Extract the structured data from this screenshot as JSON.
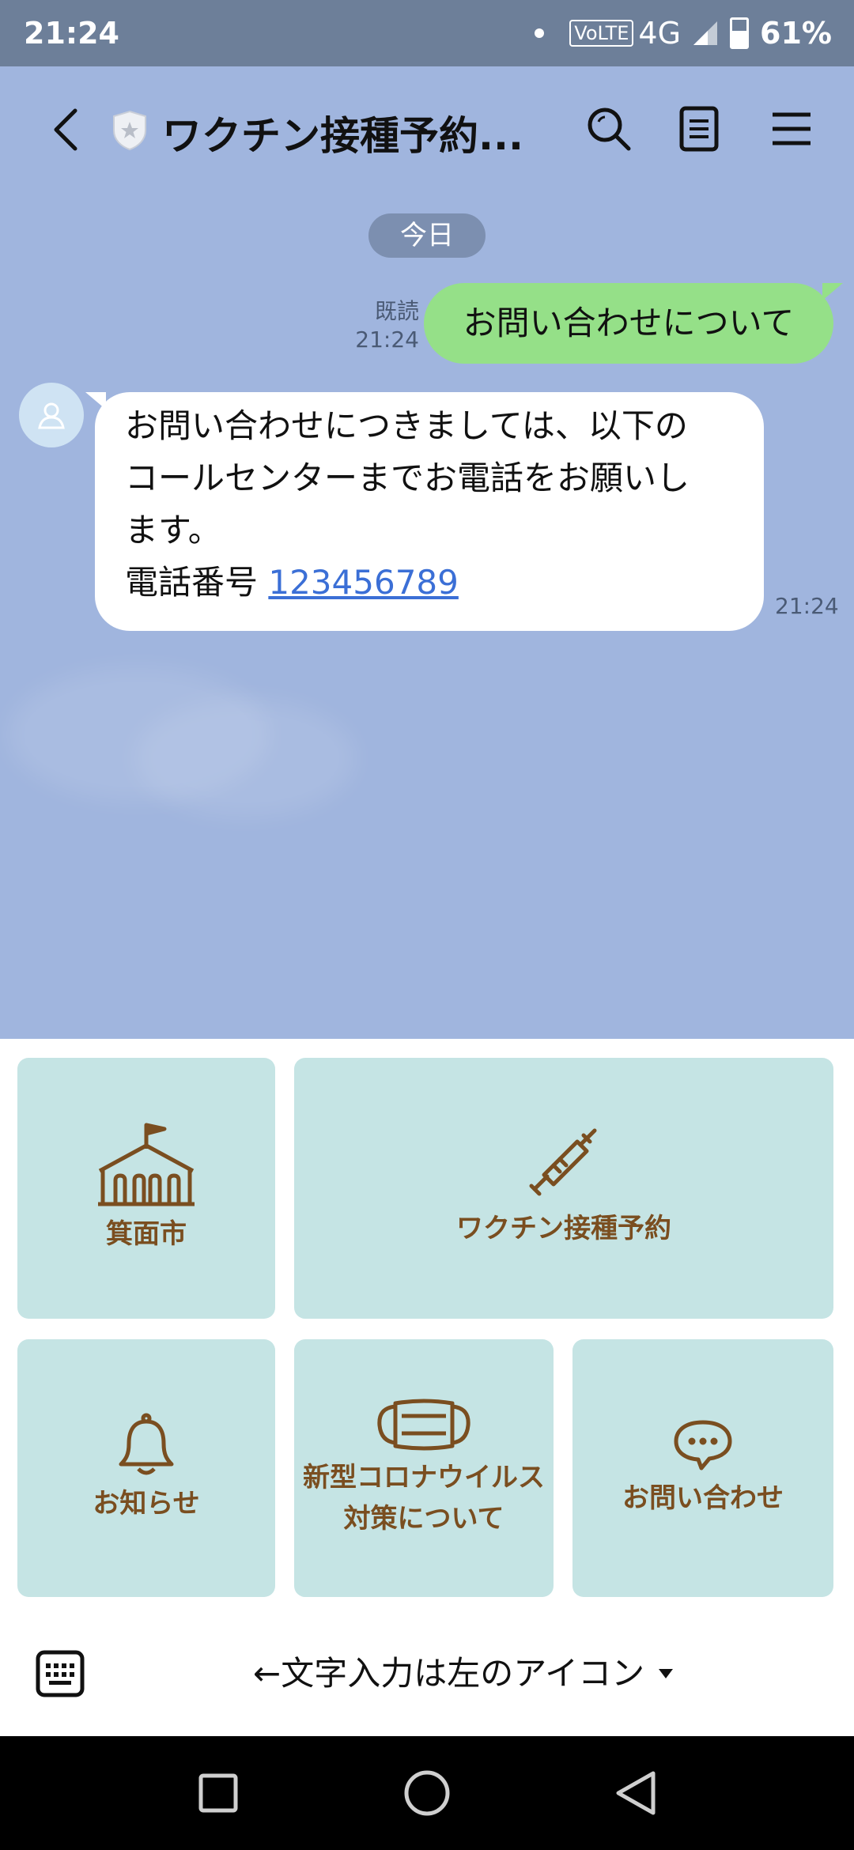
{
  "status_bar": {
    "time": "21:24",
    "volte": "VoLTE",
    "network": "4G",
    "battery": "61%"
  },
  "header": {
    "title": "ワクチン接種予約...",
    "icons": [
      "back-arrow-icon",
      "shield-star-icon",
      "search-icon",
      "notes-icon",
      "menu-icon"
    ]
  },
  "chat": {
    "date_label": "今日",
    "outgoing": {
      "text": "お問い合わせについて",
      "read_label": "既読",
      "time": "21:24"
    },
    "incoming": {
      "lines": [
        "お問い合わせにつきましては、以下の",
        "コールセンターまでお電話をお願いし",
        "ます。"
      ],
      "phone_label": "電話番号 ",
      "phone_number": "123456789",
      "time": "21:24"
    }
  },
  "rich_menu": {
    "tiles": [
      {
        "label": "箕面市",
        "icon": "school-icon"
      },
      {
        "label": "ワクチン接種予約",
        "icon": "syringe-icon"
      },
      {
        "label": "お知らせ",
        "icon": "bell-icon"
      },
      {
        "label_line1": "新型コロナウイルス",
        "label_line2": "対策について",
        "icon": "mask-icon"
      },
      {
        "label": "お問い合わせ",
        "icon": "chat-bubble-icon"
      }
    ]
  },
  "input_bar": {
    "hint": "←文字入力は左のアイコン"
  },
  "colors": {
    "chat_background": "#a0b5de",
    "outgoing_bubble": "#95e088",
    "tile_background": "#c5e4e4",
    "tile_text": "#7a4e20",
    "link": "#3b6fd6"
  }
}
